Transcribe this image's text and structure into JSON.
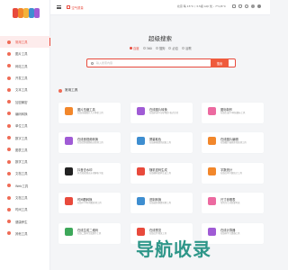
{
  "brand": {
    "colors": [
      "#e84a3c",
      "#f2872b",
      "#f3b23a",
      "#3e8ed0",
      "#a05bd5"
    ]
  },
  "topbar": {
    "link_label": "空气质量",
    "weather": "北京 晴 15°C / 3.5级 AQI 优 - 7°C/6°C"
  },
  "sidebar": {
    "items": [
      {
        "label": "常用工具",
        "active": true
      },
      {
        "label": "图片工具"
      },
      {
        "label": "网站工具"
      },
      {
        "label": "开发工具"
      },
      {
        "label": "文本工具"
      },
      {
        "label": "加密解密"
      },
      {
        "label": "编码转换"
      },
      {
        "label": "单位工具"
      },
      {
        "label": "数字工具"
      },
      {
        "label": "图表工具"
      },
      {
        "label": "数学工具"
      },
      {
        "label": "文档工具"
      },
      {
        "label": "Web工具"
      },
      {
        "label": "文档工具"
      },
      {
        "label": "时间工具"
      },
      {
        "label": "健康养生"
      },
      {
        "label": "其他工具"
      }
    ]
  },
  "search": {
    "title": "超级搜索",
    "engines": [
      {
        "label": "百度",
        "selected": true
      },
      {
        "label": "360"
      },
      {
        "label": "搜狗"
      },
      {
        "label": "必应"
      },
      {
        "label": "谷歌"
      }
    ],
    "placeholder": "输入搜索内容",
    "button_label": "搜索"
  },
  "section": {
    "title": "常用工具"
  },
  "cards": [
    {
      "title": "图片压缩工具",
      "desc": "在线压缩图片大小体积工具",
      "icon_color": "#f2872b"
    },
    {
      "title": "在线图片转换",
      "desc": "在线jpg/png/gif图片格式互转",
      "icon_color": "#a05bd5"
    },
    {
      "title": "图标制作",
      "desc": "在线生成ico网站图标工具",
      "icon_color": "#ec6aa0"
    },
    {
      "title": "在线音视频转换",
      "desc": "在线音频视频格式转换工具",
      "icon_color": "#a05bd5"
    },
    {
      "title": "屏幕取色",
      "desc": "在线屏幕颜色拾取工具",
      "icon_color": "#3e8ed0"
    },
    {
      "title": "在线图片编辑",
      "desc": "在线图片编辑美化处理工具",
      "icon_color": "#f2872b"
    },
    {
      "title": "抖音去水印",
      "desc": "抖音短视频无水印解析下载",
      "icon_color": "#222222"
    },
    {
      "title": "随机密码生成",
      "desc": "在线随机密码生成工具",
      "icon_color": "#e84a3c"
    },
    {
      "title": "字数统计",
      "desc": "在线文本字数统计工具",
      "icon_color": "#f2872b"
    },
    {
      "title": "时间戳转换",
      "desc": "在线unix时间戳转换工具",
      "icon_color": "#e84a3c"
    },
    {
      "title": "进制转换",
      "desc": "在线进制换算转换工具",
      "icon_color": "#3e8ed0"
    },
    {
      "title": "尺寸参照表",
      "desc": "常用尺寸对照参考表",
      "icon_color": "#ec6aa0"
    },
    {
      "title": "在线生成二维码",
      "desc": "在线二维码生成制作工具",
      "icon_color": "#3ea85a"
    },
    {
      "title": "在线预览",
      "desc": "在线文件预览工具",
      "icon_color": "#e84a3c"
    },
    {
      "title": "在线计算器",
      "desc": "在线科学计算器工具",
      "icon_color": "#a05bd5"
    }
  ]
}
